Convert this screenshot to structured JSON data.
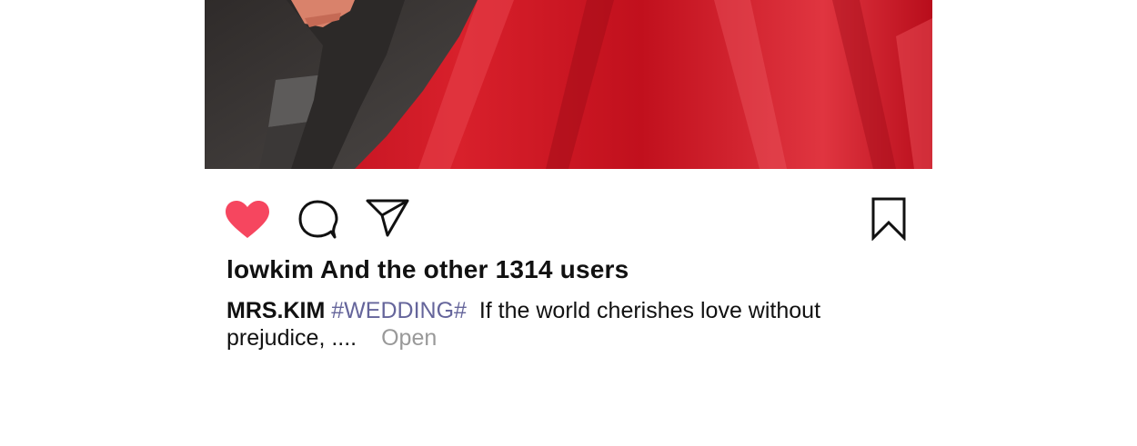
{
  "post": {
    "photo": {
      "icon": "wedding-photo",
      "colors": {
        "dress": "#d01822",
        "suit": "#3a3634",
        "skin": "#d9826b"
      }
    },
    "actions": {
      "like_icon": "heart-icon",
      "liked": true,
      "like_color": "#f6465f",
      "comment_icon": "comment-bubble-icon",
      "share_icon": "send-icon",
      "save_icon": "bookmark-icon"
    },
    "likes_text": "lowkim And the other 1314 users",
    "caption": {
      "username": "MRS.KIM",
      "hashtag": "#WEDDING#",
      "text": "If the world cherishes love without prejudice, ....",
      "open_label": "Open"
    },
    "colors": {
      "hashtag": "#65659b",
      "open": "#999999"
    }
  }
}
